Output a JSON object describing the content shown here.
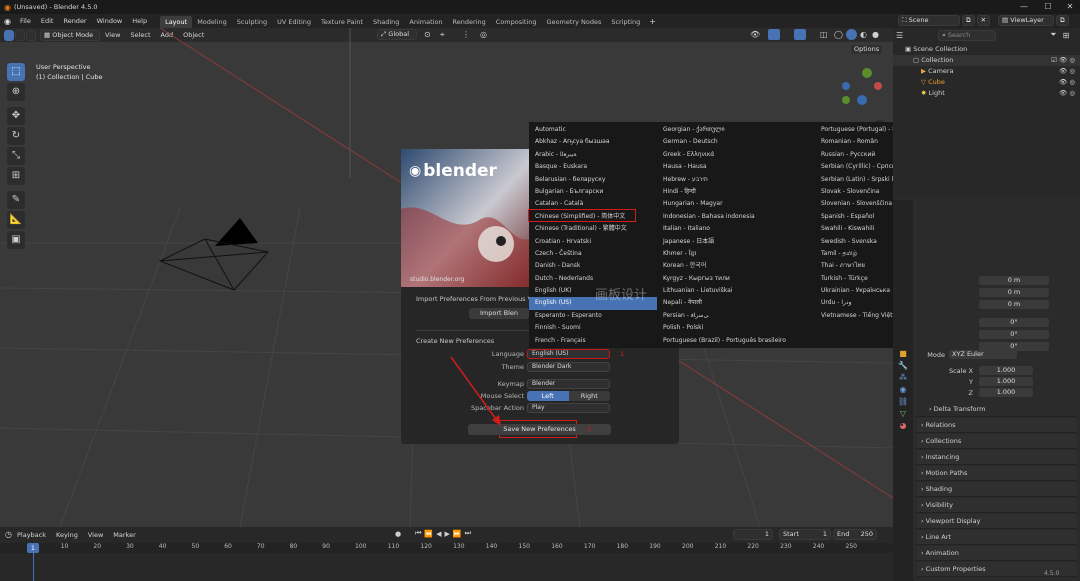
{
  "title": "(Unsaved) - Blender 4.5.0",
  "menu": [
    "File",
    "Edit",
    "Render",
    "Window",
    "Help"
  ],
  "workspaces": [
    "Layout",
    "Modeling",
    "Sculpting",
    "UV Editing",
    "Texture Paint",
    "Shading",
    "Animation",
    "Rendering",
    "Compositing",
    "Geometry Nodes",
    "Scripting"
  ],
  "scene_label": "Scene",
  "view_layer_label": "ViewLayer",
  "viewport": {
    "mode": "Object Mode",
    "menus": [
      "View",
      "Select",
      "Add",
      "Object"
    ],
    "transform": "Global",
    "options": "Options",
    "overlay_line1": "User Perspective",
    "overlay_line2": "(1) Collection | Cube"
  },
  "outliner": {
    "search_placeholder": "Search",
    "rows": [
      "Scene Collection",
      "Collection",
      "Camera",
      "Cube",
      "Light"
    ]
  },
  "splash": {
    "logo_text": "blender",
    "url": "studio.blender.org",
    "import_heading": "Import Preferences From Previous Ve",
    "import_button": "Import Blen",
    "create_heading": "Create New Preferences",
    "labels": {
      "language": "Language",
      "theme": "Theme",
      "keymap": "Keymap",
      "mouse_select": "Mouse Select",
      "spacebar": "Spacebar Action"
    },
    "values": {
      "language": "English (US)",
      "theme": "Blender Dark",
      "keymap": "Blender",
      "mouse_left": "Left",
      "mouse_right": "Right",
      "spacebar": "Play"
    },
    "save_button": "Save New Preferences",
    "annotation_1": "1",
    "annotation_2": "2"
  },
  "languages": {
    "col1": [
      "Automatic",
      "Abkhaz - Аҧсуа бызшәа",
      "Arabic - ﺔﻴﺑﺮﻌﻟﺍ",
      "Basque - Euskara",
      "Belarusian - беларуску",
      "Bulgarian - Български",
      "Catalan - Català",
      "Chinese (Simplified) - 简体中文",
      "Chinese (Traditional) - 繁體中文",
      "Croatian - Hrvatski",
      "Czech - Čeština",
      "Danish - Dansk",
      "Dutch - Nederlands",
      "English (UK)",
      "English (US)",
      "Esperanto - Esperanto",
      "Finnish - Suomi",
      "French - Français"
    ],
    "col2": [
      "Georgian - ქართული",
      "German - Deutsch",
      "Greek - Ελληνικά",
      "Hausa - Hausa",
      "Hebrew - תירבע",
      "Hindi - हिन्दी",
      "Hungarian - Magyar",
      "Indonesian - Bahasa indonesia",
      "Italian - Italiano",
      "Japanese - 日本語",
      "Khmer - ខ្មែរ",
      "Korean - 한국어",
      "Kyrgyz - Кыргыз тили",
      "Lithuanian - Lietuviškai",
      "Nepali - नेपाली",
      "Persian - ﯽﺳﺭﺎﻓ",
      "Polish - Polski",
      "Portuguese (Brazil) - Português brasileiro"
    ],
    "col3": [
      "Portuguese (Portugal) - Português europeu",
      "Romanian - Român",
      "Russian - Русский",
      "Serbian (Cyrillic) - Српски",
      "Serbian (Latin) - Srpski latinica",
      "Slovak - Slovenčina",
      "Slovenian - Slovenščina",
      "Spanish - Español",
      "Swahili - Kiswahili",
      "Swedish - Svenska",
      "Tamil - தமிழ்",
      "Thai - ภาษาไทย",
      "Turkish - Türkçe",
      "Ukrainian - Українська",
      "Urdu - ﻭﺩﺭﺍ",
      "Vietnamese - Tiếng Việt"
    ]
  },
  "properties": {
    "fields": [
      "0 m",
      "0 m",
      "0 m",
      "0°",
      "0°",
      "0°"
    ],
    "mode_label": "Mode",
    "mode_value": "XYZ Euler",
    "scale_labels": [
      "Scale X",
      "Y",
      "Z"
    ],
    "scale_values": [
      "1.000",
      "1.000",
      "1.000"
    ],
    "sections": [
      "Delta Transform",
      "Relations",
      "Collections",
      "Instancing",
      "Motion Paths",
      "Shading",
      "Visibility",
      "Viewport Display",
      "Line Art",
      "Animation",
      "Custom Properties"
    ]
  },
  "timeline": {
    "menus": [
      "Playback",
      "Keying",
      "View",
      "Marker"
    ],
    "current_frame": "1",
    "start_label": "Start",
    "start": "1",
    "end_label": "End",
    "end": "250",
    "ticks": [
      "1",
      "10",
      "20",
      "30",
      "40",
      "50",
      "60",
      "70",
      "80",
      "90",
      "100",
      "110",
      "120",
      "130",
      "140",
      "150",
      "160",
      "170",
      "180",
      "190",
      "200",
      "210",
      "220",
      "230",
      "240",
      "250"
    ]
  },
  "version": "4.5.0",
  "watermark": "画板设计",
  "colors": {
    "accent": "#4772b3",
    "annotation": "#d11c1c",
    "bg": "#393939"
  }
}
